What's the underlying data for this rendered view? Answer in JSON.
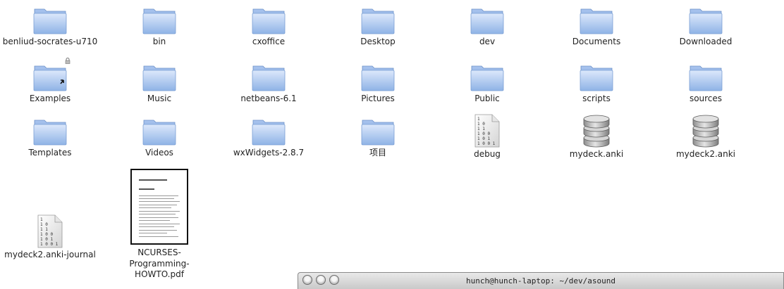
{
  "desktop": {
    "items": [
      {
        "label": "benliud-socrates-u710",
        "icon": "folder-icon"
      },
      {
        "label": "bin",
        "icon": "folder-icon"
      },
      {
        "label": "cxoffice",
        "icon": "folder-icon"
      },
      {
        "label": "Desktop",
        "icon": "folder-icon"
      },
      {
        "label": "dev",
        "icon": "folder-icon"
      },
      {
        "label": "Documents",
        "icon": "folder-icon"
      },
      {
        "label": "Downloaded",
        "icon": "folder-icon"
      },
      {
        "label": "Examples",
        "icon": "folder-link-icon"
      },
      {
        "label": "Music",
        "icon": "folder-icon"
      },
      {
        "label": "netbeans-6.1",
        "icon": "folder-icon"
      },
      {
        "label": "Pictures",
        "icon": "folder-icon"
      },
      {
        "label": "Public",
        "icon": "folder-icon"
      },
      {
        "label": "scripts",
        "icon": "folder-icon"
      },
      {
        "label": "sources",
        "icon": "folder-icon"
      },
      {
        "label": "Templates",
        "icon": "folder-icon"
      },
      {
        "label": "Videos",
        "icon": "folder-icon"
      },
      {
        "label": "wxWidgets-2.8.7",
        "icon": "folder-icon"
      },
      {
        "label": "项目",
        "icon": "folder-icon"
      },
      {
        "label": "debug",
        "icon": "binary-file-icon"
      },
      {
        "label": "mydeck.anki",
        "icon": "database-icon"
      },
      {
        "label": "mydeck2.anki",
        "icon": "database-icon"
      },
      {
        "label": "mydeck2.anki-journal",
        "icon": "binary-file-icon"
      },
      {
        "label": "NCURSES-Programming-HOWTO.pdf",
        "icon": "pdf-thumbnail-icon"
      }
    ]
  },
  "terminal": {
    "title": "hunch@hunch-laptop: ~/dev/asound"
  },
  "colors": {
    "folder_light": "#c9dcf7",
    "folder_dark": "#7ea6e0",
    "background": "#ffffff"
  }
}
